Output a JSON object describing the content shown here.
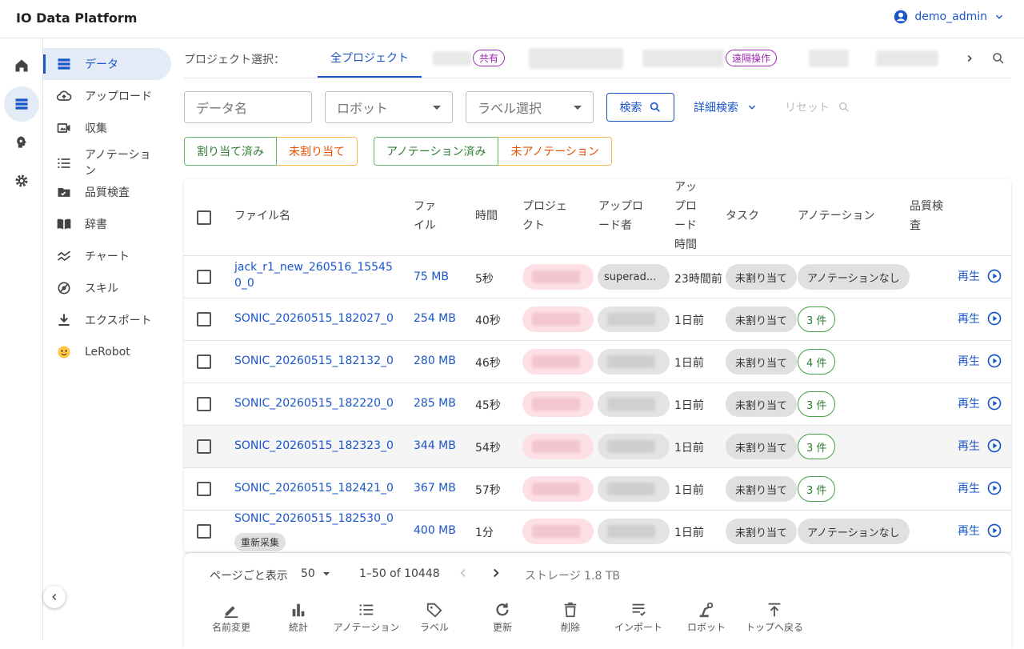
{
  "app": {
    "title": "IO Data Platform",
    "user": "demo_admin"
  },
  "rail": [
    "home-icon",
    "data-icon",
    "brain-icon",
    "gear-icon"
  ],
  "sidebar": {
    "items": [
      {
        "label": "データ",
        "icon": "data-list-icon",
        "active": true
      },
      {
        "label": "アップロード",
        "icon": "cloud-upload-icon"
      },
      {
        "label": "収集",
        "icon": "video-collect-icon"
      },
      {
        "label": "アノテーション",
        "icon": "annotation-list-icon"
      },
      {
        "label": "品質検査",
        "icon": "quality-check-icon"
      },
      {
        "label": "辞書",
        "icon": "book-icon"
      },
      {
        "label": "チャート",
        "icon": "chart-icon"
      },
      {
        "label": "スキル",
        "icon": "skill-icon"
      },
      {
        "label": "エクスポート",
        "icon": "download-icon"
      },
      {
        "label": "LeRobot",
        "icon": "hugging-face-icon"
      }
    ]
  },
  "projects": {
    "label": "プロジェクト選択：",
    "all_tab": "全プロジェクト",
    "shared_chip": "共有",
    "remote_chip": "遠隔操作"
  },
  "filters": {
    "name_placeholder": "データ名",
    "robot_placeholder": "ロボット",
    "label_placeholder": "ラベル選択",
    "search": "検索",
    "advanced": "詳細検索",
    "reset": "リセット"
  },
  "toggles": {
    "assigned": "割り当て済み",
    "unassigned": "未割り当て",
    "annotated": "アノテーション済み",
    "unannotated": "未アノテーション"
  },
  "table": {
    "headers": {
      "file_name": "ファイル名",
      "file": "ファ\nイル",
      "duration": "時間",
      "project": "プロジェ\nクト",
      "uploader": "アップロ\nード者",
      "upload_time": "アッ\nプロ\nード\n時間",
      "task": "タスク",
      "annotation": "アノテーション",
      "quality": "品質検\n査"
    },
    "rows": [
      {
        "name": "jack_r1_new_260516_155450_0",
        "size": "75 MB",
        "duration": "5秒",
        "uploader": "superad...",
        "time": "23時間前",
        "task": "未割り当て",
        "annotation": "アノテーションなし",
        "play": "再生"
      },
      {
        "name": "SONIC_20260515_182027_0",
        "size": "254 MB",
        "duration": "40秒",
        "uploader": "",
        "time": "1日前",
        "task": "未割り当て",
        "annotation": "3 件",
        "play": "再生"
      },
      {
        "name": "SONIC_20260515_182132_0",
        "size": "280 MB",
        "duration": "46秒",
        "uploader": "",
        "time": "1日前",
        "task": "未割り当て",
        "annotation": "4 件",
        "play": "再生"
      },
      {
        "name": "SONIC_20260515_182220_0",
        "size": "285 MB",
        "duration": "45秒",
        "uploader": "",
        "time": "1日前",
        "task": "未割り当て",
        "annotation": "3 件",
        "play": "再生"
      },
      {
        "name": "SONIC_20260515_182323_0",
        "size": "344 MB",
        "duration": "54秒",
        "uploader": "",
        "time": "1日前",
        "task": "未割り当て",
        "annotation": "3 件",
        "play": "再生"
      },
      {
        "name": "SONIC_20260515_182421_0",
        "size": "367 MB",
        "duration": "57秒",
        "uploader": "",
        "time": "1日前",
        "task": "未割り当て",
        "annotation": "3 件",
        "play": "再生"
      },
      {
        "name": "SONIC_20260515_182530_0",
        "tag": "重新采集",
        "size": "400 MB",
        "duration": "1分",
        "uploader": "",
        "time": "1日前",
        "task": "未割り当て",
        "annotation": "アノテーションなし",
        "play": "再生"
      }
    ]
  },
  "pagination": {
    "per_page_label": "ページごと表示",
    "per_page": "50",
    "range": "1–50 of 10448",
    "storage": "ストレージ 1.8 TB"
  },
  "actions": [
    {
      "label": "名前変更",
      "icon": "rename-icon"
    },
    {
      "label": "統計",
      "icon": "stats-icon"
    },
    {
      "label": "アノテーション",
      "icon": "annotation-icon"
    },
    {
      "label": "ラベル",
      "icon": "label-icon"
    },
    {
      "label": "更新",
      "icon": "refresh-icon"
    },
    {
      "label": "削除",
      "icon": "delete-icon"
    },
    {
      "label": "インポート",
      "icon": "import-icon"
    },
    {
      "label": "ロボット",
      "icon": "robot-icon"
    },
    {
      "label": "トップへ戻る",
      "icon": "back-to-top-icon"
    }
  ],
  "colors": {
    "accent": "#1a56c9",
    "green": "#2e7d32",
    "orange": "#e65100",
    "purple": "#9c27b0"
  }
}
